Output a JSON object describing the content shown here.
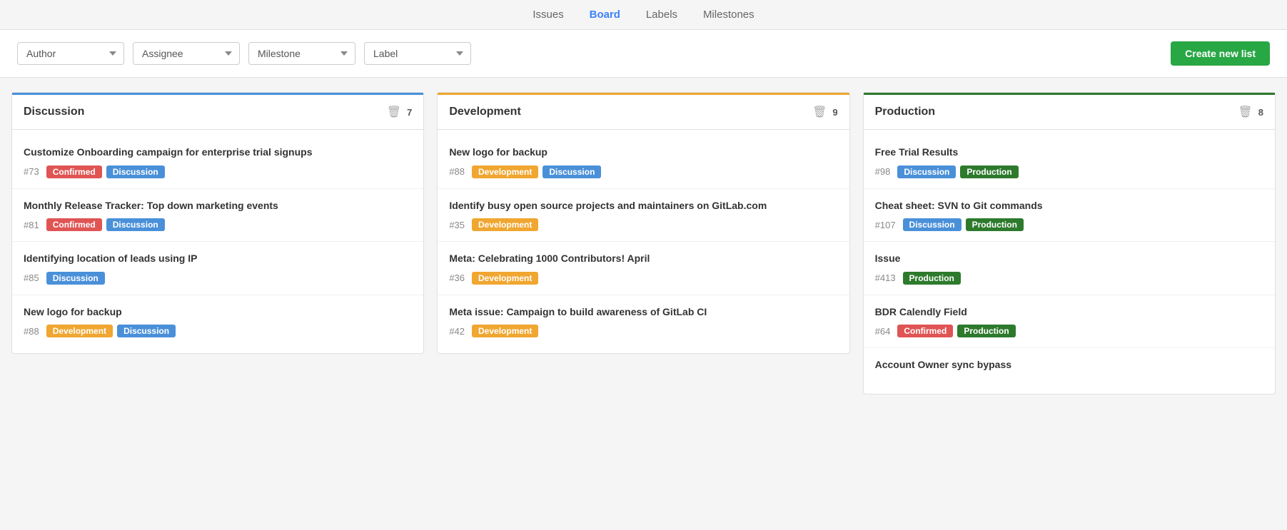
{
  "nav": {
    "items": [
      {
        "label": "Issues",
        "active": false
      },
      {
        "label": "Board",
        "active": true
      },
      {
        "label": "Labels",
        "active": false
      },
      {
        "label": "Milestones",
        "active": false
      }
    ]
  },
  "filters": {
    "author": {
      "label": "Author",
      "placeholder": "Author"
    },
    "assignee": {
      "label": "Assignee",
      "placeholder": "Assignee"
    },
    "milestone": {
      "label": "Milestone",
      "placeholder": "Milestone"
    },
    "label": {
      "label": "Label",
      "placeholder": "Label"
    }
  },
  "create_button": "Create new list",
  "columns": [
    {
      "id": "discussion",
      "title": "Discussion",
      "color": "blue",
      "count": 7,
      "issues": [
        {
          "title": "Customize Onboarding campaign for enterprise trial signups",
          "number": "#73",
          "labels": [
            {
              "text": "Confirmed",
              "class": "label-confirmed"
            },
            {
              "text": "Discussion",
              "class": "label-discussion"
            }
          ]
        },
        {
          "title": "Monthly Release Tracker: Top down marketing events",
          "number": "#81",
          "labels": [
            {
              "text": "Confirmed",
              "class": "label-confirmed"
            },
            {
              "text": "Discussion",
              "class": "label-discussion"
            }
          ]
        },
        {
          "title": "Identifying location of leads using IP",
          "number": "#85",
          "labels": [
            {
              "text": "Discussion",
              "class": "label-discussion"
            }
          ]
        },
        {
          "title": "New logo for backup",
          "number": "#88",
          "labels": [
            {
              "text": "Development",
              "class": "label-development"
            },
            {
              "text": "Discussion",
              "class": "label-discussion"
            }
          ]
        }
      ]
    },
    {
      "id": "development",
      "title": "Development",
      "color": "orange",
      "count": 9,
      "issues": [
        {
          "title": "New logo for backup",
          "number": "#88",
          "labels": [
            {
              "text": "Development",
              "class": "label-development"
            },
            {
              "text": "Discussion",
              "class": "label-discussion"
            }
          ]
        },
        {
          "title": "Identify busy open source projects and maintainers on GitLab.com",
          "number": "#35",
          "labels": [
            {
              "text": "Development",
              "class": "label-development"
            }
          ]
        },
        {
          "title": "Meta: Celebrating 1000 Contributors! April",
          "number": "#36",
          "labels": [
            {
              "text": "Development",
              "class": "label-development"
            }
          ]
        },
        {
          "title": "Meta issue: Campaign to build awareness of GitLab CI",
          "number": "#42",
          "labels": [
            {
              "text": "Development",
              "class": "label-development"
            }
          ]
        }
      ]
    },
    {
      "id": "production",
      "title": "Production",
      "color": "green",
      "count": 8,
      "issues": [
        {
          "title": "Free Trial Results",
          "number": "#98",
          "labels": [
            {
              "text": "Discussion",
              "class": "label-discussion"
            },
            {
              "text": "Production",
              "class": "label-production"
            }
          ]
        },
        {
          "title": "Cheat sheet: SVN to Git commands",
          "number": "#107",
          "labels": [
            {
              "text": "Discussion",
              "class": "label-discussion"
            },
            {
              "text": "Production",
              "class": "label-production"
            }
          ]
        },
        {
          "title": "Issue",
          "number": "#413",
          "labels": [
            {
              "text": "Production",
              "class": "label-production"
            }
          ]
        },
        {
          "title": "BDR Calendly Field",
          "number": "#64",
          "labels": [
            {
              "text": "Confirmed",
              "class": "label-confirmed"
            },
            {
              "text": "Production",
              "class": "label-production"
            }
          ]
        },
        {
          "title": "Account Owner sync bypass",
          "number": "",
          "labels": []
        }
      ]
    }
  ]
}
